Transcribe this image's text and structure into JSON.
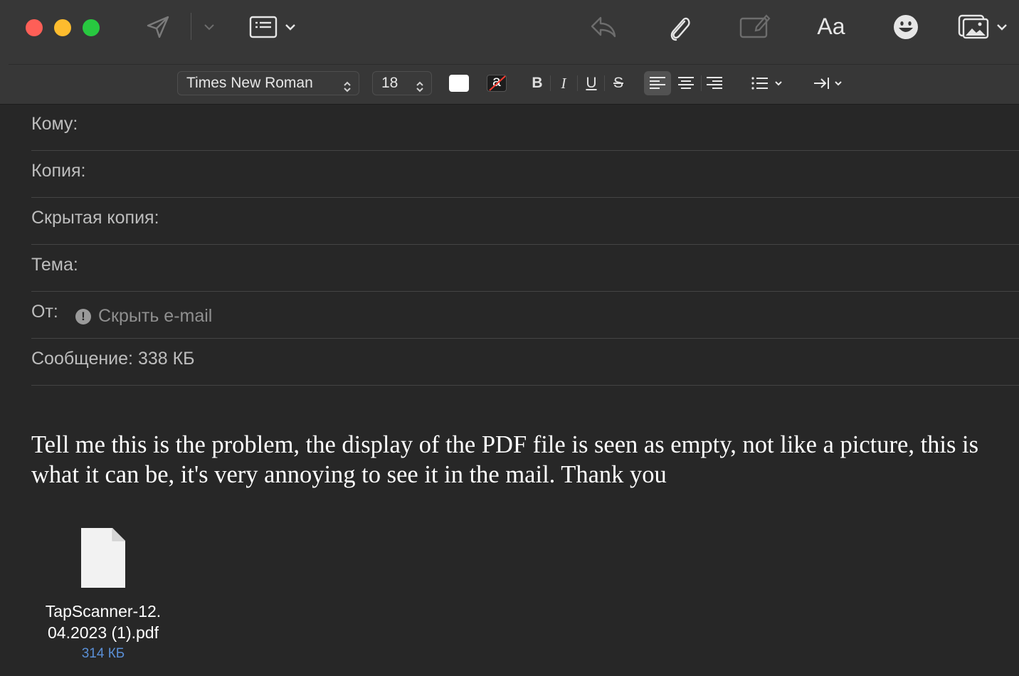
{
  "toolbar": {
    "font_name": "Times New Roman",
    "font_size": "18",
    "text_color": "#ffffff",
    "font_button_label": "Aa",
    "bold_label": "B",
    "italic_label": "I",
    "underline_label": "U",
    "strike_label": "S",
    "highlight_label": "a"
  },
  "fields": {
    "to_label": "Кому:",
    "cc_label": "Копия:",
    "bcc_label": "Скрытая копия:",
    "subject_label": "Тема:",
    "from_label": "От:",
    "from_value": "Скрыть e-mail",
    "message_label": "Сообщение: 338 КБ"
  },
  "body": {
    "text": "Tell me this is the problem, the display of the PDF file is seen as empty, not like a picture, this is what it can be, it's very annoying to see it in the mail. Thank you"
  },
  "attachment": {
    "filename": "TapScanner-12.04.2023 (1).pdf",
    "size": "314 КБ"
  },
  "colors": {
    "background": "#272727",
    "toolbar": "#373737",
    "close": "#fe5f57",
    "minimize": "#febc2e",
    "zoom": "#28c840",
    "link_blue": "#5a8fd6"
  }
}
